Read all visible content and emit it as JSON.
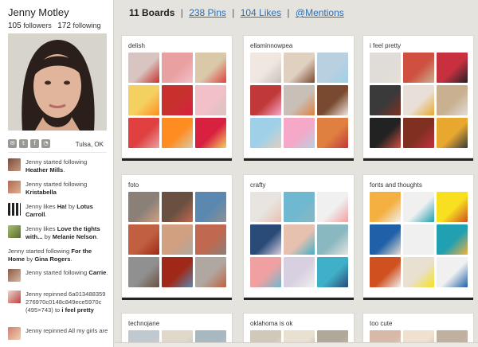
{
  "profile": {
    "name": "Jenny Motley",
    "followers_count": "105",
    "followers_label": "followers",
    "following_count": "172",
    "following_label": "following",
    "location": "Tulsa, OK"
  },
  "social_icons": [
    {
      "name": "email-icon",
      "glyph": "✉"
    },
    {
      "name": "twitter-icon",
      "glyph": "t"
    },
    {
      "name": "facebook-icon",
      "glyph": "f"
    },
    {
      "name": "rss-icon",
      "glyph": "◔"
    }
  ],
  "activity": [
    {
      "pre": "Jenny started following ",
      "bold": "Heather Mills",
      "post": "."
    },
    {
      "pre": "Jenny started following ",
      "bold": "Kristabella",
      "post": ""
    },
    {
      "pre": "Jenny likes ",
      "bold": "Ha!",
      "post": " by ",
      "bold2": "Lotus Carroll",
      "post2": "."
    },
    {
      "pre": "Jenny likes ",
      "bold": "Love the tights with...",
      "post": " by ",
      "bold2": "Melanie Nelson",
      "post2": "."
    },
    {
      "pre": "Jenny started following ",
      "bold": "For the Home",
      "post": " by ",
      "bold2": "Gina Rogers",
      "post2": "."
    },
    {
      "pre": "Jenny started following ",
      "bold": "Carrie",
      "post": "."
    },
    {
      "pre": "Jenny repinned 6a013488359276970c0148c849ece5970c (495×743) to ",
      "bold": "i feel pretty",
      "post": ""
    },
    {
      "pre": "Jenny repinned All my girls are",
      "bold": "",
      "post": ""
    }
  ],
  "nav": {
    "boards": "11 Boards",
    "sep": "|",
    "pins": "238 Pins",
    "likes": "104 Likes",
    "mentions": "@Mentions"
  },
  "boards": [
    {
      "title": "delish"
    },
    {
      "title": "ellaminnowpea"
    },
    {
      "title": "i feel pretty"
    },
    {
      "title": "foto"
    },
    {
      "title": "crafty"
    },
    {
      "title": "fonts and thoughts"
    },
    {
      "title": "technojane"
    },
    {
      "title": "oklahoma is ok"
    },
    {
      "title": "too cute"
    }
  ],
  "colors": {
    "link": "#2a6fb5",
    "background": "#e5e3de"
  }
}
